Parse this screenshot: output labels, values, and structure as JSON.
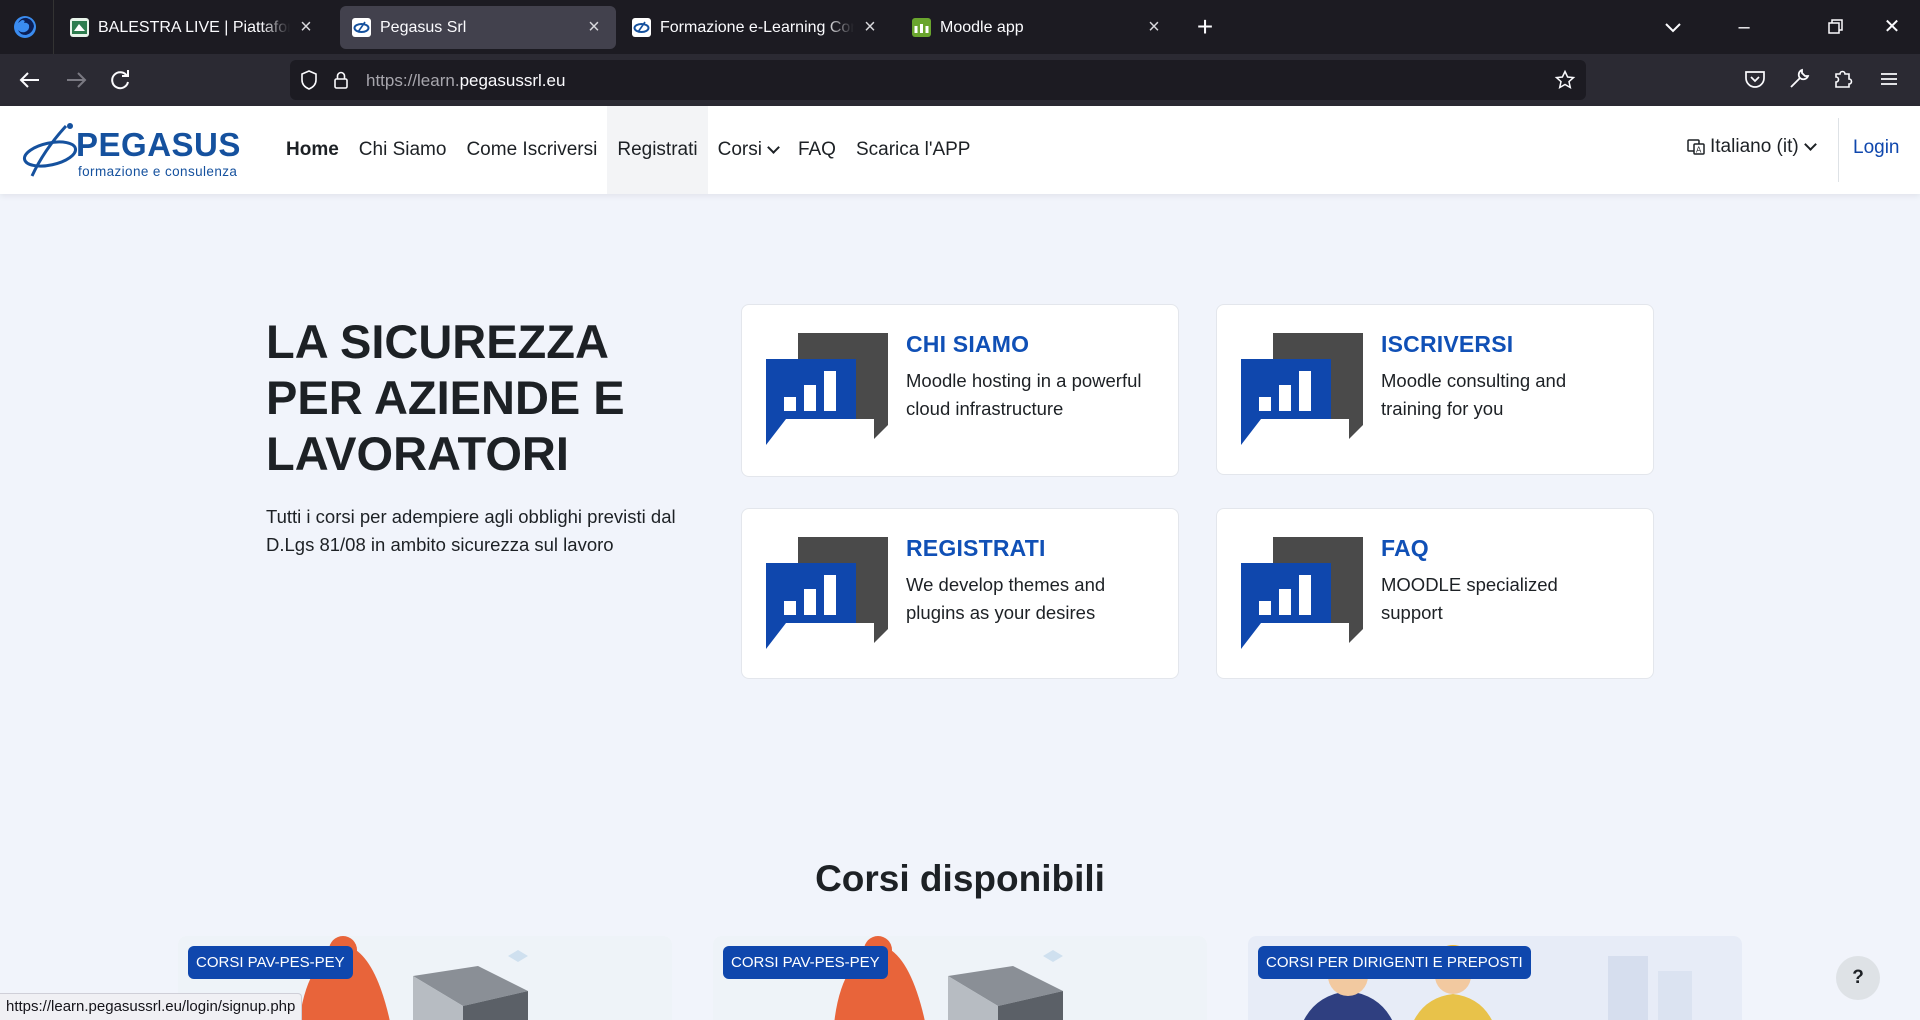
{
  "browser": {
    "tabs": [
      {
        "title": "BALESTRA LIVE | Piattaforma e-Learning",
        "active": false
      },
      {
        "title": "Pegasus Srl",
        "active": true
      },
      {
        "title": "Formazione e-Learning Corsi Sicurezza",
        "active": false
      },
      {
        "title": "Moodle app",
        "active": false
      }
    ],
    "url_prefix": "https://learn.",
    "url_domain": "pegasussrl.eu",
    "status_url": "https://learn.pegasussrl.eu/login/signup.php"
  },
  "site": {
    "logo_word": "PEGASUS",
    "logo_sub": "formazione e consulenza",
    "menu": [
      {
        "label": "Home"
      },
      {
        "label": "Chi Siamo"
      },
      {
        "label": "Come Iscriversi"
      },
      {
        "label": "Registrati"
      },
      {
        "label": "Corsi"
      },
      {
        "label": "FAQ"
      },
      {
        "label": "Scarica l'APP"
      }
    ],
    "language": "Italiano ‎(it)‎",
    "login": "Login"
  },
  "hero": {
    "title": "LA SICUREZZA PER AZIENDE E LAVORATORI",
    "description": "Tutti i corsi per adempiere agli obblighi previsti dal D.Lgs 81/08 in ambito sicurezza sul lavoro"
  },
  "cards": [
    {
      "title": "CHI SIAMO",
      "text": "Moodle hosting in a powerful cloud infrastructure"
    },
    {
      "title": "ISCRIVERSI",
      "text": "Moodle consulting and training for you"
    },
    {
      "title": "REGISTRATI",
      "text": "We develop themes and plugins as your desires"
    },
    {
      "title": "FAQ",
      "text": "MOODLE specialized support"
    }
  ],
  "courses_section": {
    "title": "Corsi disponibili",
    "courses": [
      {
        "badge": "CORSI PAV-PES-PEY"
      },
      {
        "badge": "CORSI PAV-PES-PEY"
      },
      {
        "badge": "CORSI PER DIRIGENTI E PREPOSTI"
      }
    ]
  },
  "help_label": "?",
  "colors": {
    "brand_blue": "#1050b6",
    "link_blue": "#0f47ad",
    "page_bg": "#f1f4fb",
    "icon_dark": "#4a4a4a"
  }
}
